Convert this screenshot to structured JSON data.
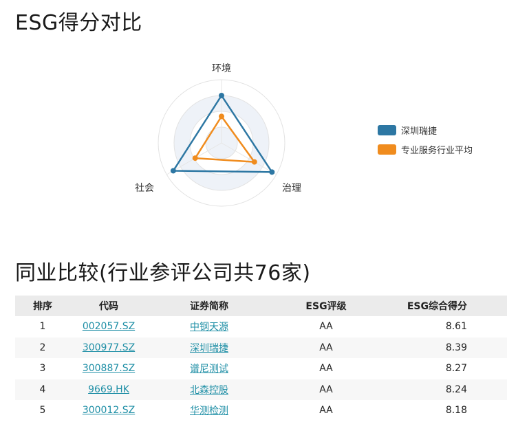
{
  "esg_section": {
    "title": "ESG得分对比"
  },
  "peer_section": {
    "title": "同业比较(行业参评公司共76家)"
  },
  "chart_data": {
    "type": "radar",
    "axes": [
      "环境",
      "治理",
      "社会"
    ],
    "range": [
      0,
      100
    ],
    "series": [
      {
        "name": "深圳瑞捷",
        "color": "#2d77a3",
        "values": [
          75,
          92,
          88
        ]
      },
      {
        "name": "专业服务行业平均",
        "color": "#f08c1e",
        "values": [
          42,
          60,
          48
        ]
      }
    ],
    "legend_position": "right"
  },
  "table": {
    "headers": {
      "rank": "排序",
      "code": "代码",
      "name": "证券简称",
      "rating": "ESG评级",
      "score": "ESG综合得分"
    },
    "rows": [
      {
        "rank": "1",
        "code": "002057.SZ",
        "name": "中钢天源",
        "rating": "AA",
        "score": "8.61"
      },
      {
        "rank": "2",
        "code": "300977.SZ",
        "name": "深圳瑞捷",
        "rating": "AA",
        "score": "8.39"
      },
      {
        "rank": "3",
        "code": "300887.SZ",
        "name": "谱尼测试",
        "rating": "AA",
        "score": "8.27"
      },
      {
        "rank": "4",
        "code": "9669.HK",
        "name": "北森控股",
        "rating": "AA",
        "score": "8.24"
      },
      {
        "rank": "5",
        "code": "300012.SZ",
        "name": "华测检测",
        "rating": "AA",
        "score": "8.18"
      }
    ]
  }
}
